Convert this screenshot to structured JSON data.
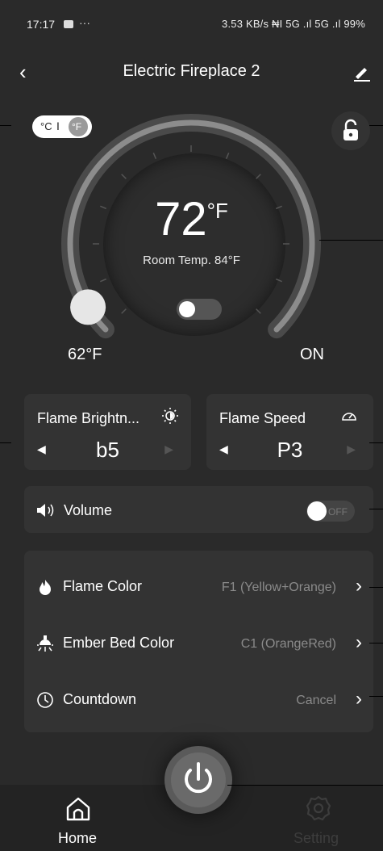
{
  "status_bar": {
    "time": "17:17",
    "right": "3.53 KB/s ₦I 5G .ıl 5G .ıl 99%"
  },
  "header": {
    "title": "Electric Fireplace 2"
  },
  "unit_toggle": {
    "celsius": "°C",
    "separator": "I",
    "fahrenheit": "°F"
  },
  "dial": {
    "set_temp": "72",
    "set_unit": "°F",
    "room_temp": "Room Temp. 84°F",
    "min_label": "62°F",
    "max_label": "ON",
    "level": 0.05
  },
  "flame_brightness": {
    "label": "Flame Brightn...",
    "value": "b5"
  },
  "flame_speed": {
    "label": "Flame Speed",
    "value": "P3"
  },
  "volume": {
    "label": "Volume",
    "state": "OFF"
  },
  "settings": [
    {
      "label": "Flame Color",
      "value": "F1 (Yellow+Orange)",
      "icon": "flame-icon"
    },
    {
      "label": "Ember Bed Color",
      "value": "C1 (OrangeRed)",
      "icon": "ember-icon"
    },
    {
      "label": "Countdown",
      "value": "Cancel",
      "icon": "clock-icon"
    }
  ],
  "nav": {
    "home": "Home",
    "setting": "Setting"
  },
  "colors": {
    "background": "#2a2a2a",
    "card": "#333333",
    "accent": "#ffffff"
  }
}
